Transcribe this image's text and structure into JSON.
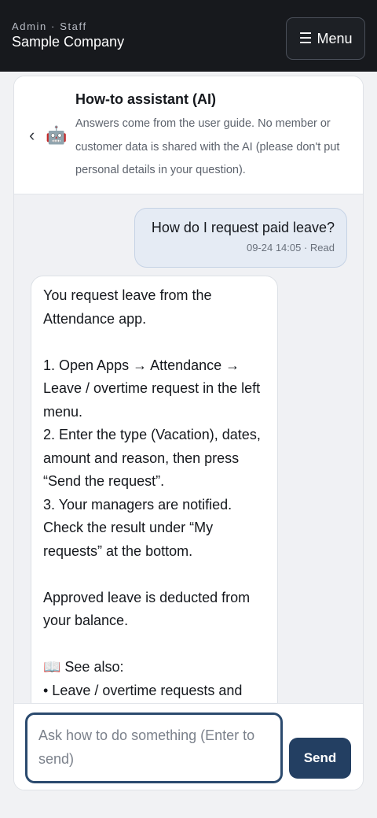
{
  "topbar": {
    "role_label": "Admin · Staff",
    "company_name": "Sample Company",
    "menu_icon": "☰",
    "menu_label": "Menu"
  },
  "chat_header": {
    "back_icon": "‹",
    "bot_icon": "🤖",
    "title": "How-to assistant (AI)",
    "description": "Answers come from the user guide. No member or customer data is shared with the AI (please don't put personal details in your question)."
  },
  "messages": {
    "user": {
      "text": "How do I request paid leave?",
      "meta": "09-24 14:05 · Read"
    },
    "bot": {
      "intro": "You request leave from the Attendance app.",
      "step1": "1. Open Apps → Attendance → Leave / overtime request in the left menu.",
      "step2": "2. Enter the type (Vacation), dates, amount and reason, then press “Send the request”.",
      "step3": "3. Your managers are notified. Check the result under “My requests” at the bottom.",
      "note": "Approved leave is deducted from your balance.",
      "see_also": "📖 See also:",
      "link1": "• Leave / overtime requests and"
    }
  },
  "composer": {
    "placeholder": "Ask how to do something (Enter to send)",
    "send_label": "Send"
  },
  "colors": {
    "topbar_bg": "#17191d",
    "accent": "#233f62",
    "user_bubble": "#e5ebf4"
  }
}
